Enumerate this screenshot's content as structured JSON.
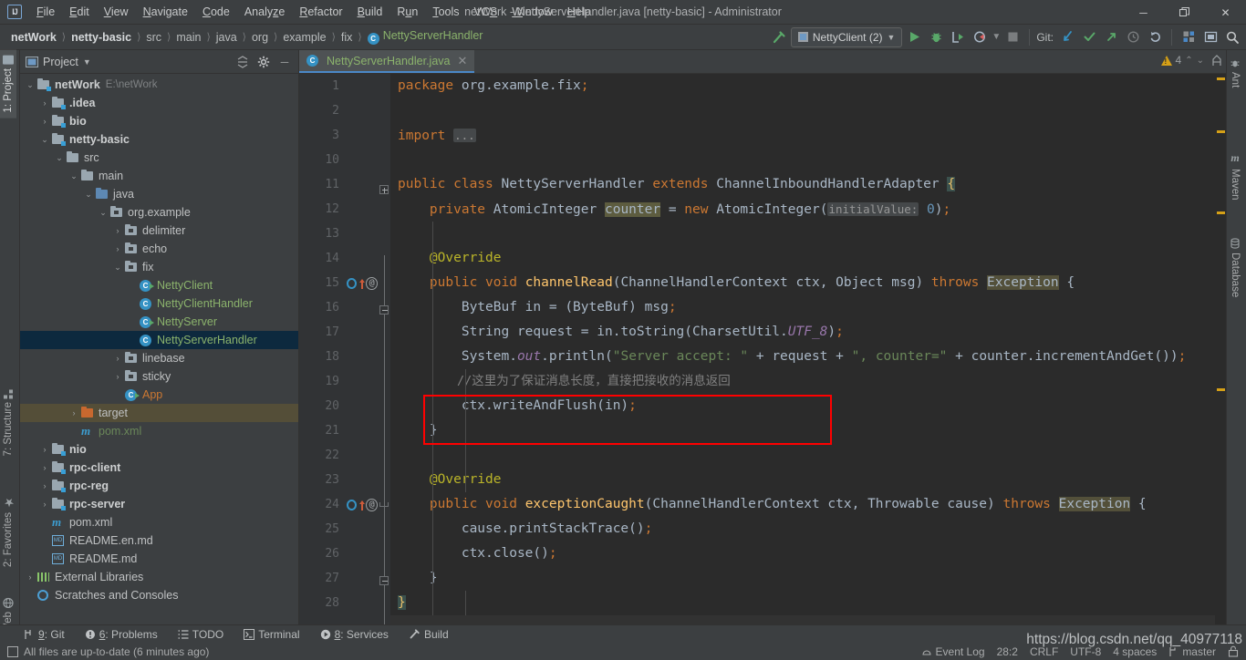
{
  "window": {
    "title": "netWork - NettyServerHandler.java [netty-basic] - Administrator",
    "logo": "IJ",
    "minimize": "─",
    "maximize": "❐",
    "close": "✕"
  },
  "menubar": [
    {
      "label": "File",
      "mnemonic": "F"
    },
    {
      "label": "Edit",
      "mnemonic": "E"
    },
    {
      "label": "View",
      "mnemonic": "V"
    },
    {
      "label": "Navigate",
      "mnemonic": "N"
    },
    {
      "label": "Code",
      "mnemonic": "C"
    },
    {
      "label": "Analyze",
      "mnemonic": "z"
    },
    {
      "label": "Refactor",
      "mnemonic": "R"
    },
    {
      "label": "Build",
      "mnemonic": "B"
    },
    {
      "label": "Run",
      "mnemonic": "u"
    },
    {
      "label": "Tools",
      "mnemonic": "T"
    },
    {
      "label": "VCS",
      "mnemonic": "S"
    },
    {
      "label": "Window",
      "mnemonic": "W"
    },
    {
      "label": "Help",
      "mnemonic": "H"
    }
  ],
  "breadcrumbs": [
    {
      "label": "netWork",
      "style": "bold"
    },
    {
      "label": "netty-basic",
      "style": "bold"
    },
    {
      "label": "src",
      "style": "plain"
    },
    {
      "label": "main",
      "style": "plain"
    },
    {
      "label": "java",
      "style": "plain"
    },
    {
      "label": "org",
      "style": "plain"
    },
    {
      "label": "example",
      "style": "plain"
    },
    {
      "label": "fix",
      "style": "plain"
    },
    {
      "label": "NettyServerHandler",
      "style": "class"
    }
  ],
  "toolbar": {
    "build_icon": "hammer-icon",
    "run_config": "NettyClient (2)",
    "run_label": "run-button",
    "debug_label": "debug-button",
    "coverage_label": "run-with-coverage-button",
    "profile_label": "profiler-button",
    "stop_label": "stop-button",
    "git_label": "Git:",
    "git_update": "update-project-icon",
    "git_commit": "commit-icon",
    "git_push": "push-icon",
    "git_history": "history-icon",
    "git_rollback": "rollback-icon",
    "settings_icon": "settings-icon",
    "layout_icon": "layout-icon",
    "search_icon": "search-icon"
  },
  "left_strip": [
    {
      "label": "1: Project",
      "icon": "project-icon",
      "selected": true
    },
    {
      "label": "7: Structure",
      "icon": "structure-icon",
      "selected": false
    },
    {
      "label": "2: Favorites",
      "icon": "star-icon",
      "selected": false
    },
    {
      "label": "Web",
      "icon": "globe-icon",
      "selected": false
    }
  ],
  "right_strip": [
    {
      "label": "Ant",
      "icon": "ant-icon"
    },
    {
      "label": "Maven",
      "icon": "maven-icon"
    },
    {
      "label": "Database",
      "icon": "database-icon"
    }
  ],
  "project_panel": {
    "title": "Project",
    "dropdown_icon": "chevron-down-icon",
    "collapse_icon": "collapse-all-icon",
    "settings_icon": "gear-icon",
    "hide_icon": "hide-icon",
    "tree": [
      {
        "depth": 0,
        "arrow": "v",
        "icon": "module-folder",
        "label": "netWork",
        "style": "b",
        "sub": "E:\\netWork"
      },
      {
        "depth": 1,
        "arrow": ">",
        "icon": "module-folder",
        "label": ".idea",
        "style": "b",
        "sub": ""
      },
      {
        "depth": 1,
        "arrow": ">",
        "icon": "module-folder",
        "label": "bio",
        "style": "b",
        "sub": ""
      },
      {
        "depth": 1,
        "arrow": "v",
        "icon": "module-folder",
        "label": "netty-basic",
        "style": "b",
        "sub": ""
      },
      {
        "depth": 2,
        "arrow": "v",
        "icon": "folder",
        "label": "src",
        "style": "plain",
        "sub": ""
      },
      {
        "depth": 3,
        "arrow": "v",
        "icon": "folder",
        "label": "main",
        "style": "plain",
        "sub": ""
      },
      {
        "depth": 4,
        "arrow": "v",
        "icon": "source-folder",
        "label": "java",
        "style": "plain",
        "sub": ""
      },
      {
        "depth": 5,
        "arrow": "v",
        "icon": "package",
        "label": "org.example",
        "style": "plain",
        "sub": ""
      },
      {
        "depth": 6,
        "arrow": ">",
        "icon": "package",
        "label": "delimiter",
        "style": "plain",
        "sub": ""
      },
      {
        "depth": 6,
        "arrow": ">",
        "icon": "package",
        "label": "echo",
        "style": "plain",
        "sub": ""
      },
      {
        "depth": 6,
        "arrow": "v",
        "icon": "package",
        "label": "fix",
        "style": "plain",
        "sub": ""
      },
      {
        "depth": 7,
        "arrow": "",
        "icon": "class-runnable",
        "label": "NettyClient",
        "style": "java",
        "sub": ""
      },
      {
        "depth": 7,
        "arrow": "",
        "icon": "class",
        "label": "NettyClientHandler",
        "style": "java",
        "sub": ""
      },
      {
        "depth": 7,
        "arrow": "",
        "icon": "class-runnable",
        "label": "NettyServer",
        "style": "java",
        "sub": ""
      },
      {
        "depth": 7,
        "arrow": "",
        "icon": "class",
        "label": "NettyServerHandler",
        "style": "java",
        "sub": "",
        "state": "sel"
      },
      {
        "depth": 6,
        "arrow": ">",
        "icon": "package",
        "label": "linebase",
        "style": "plain",
        "sub": ""
      },
      {
        "depth": 6,
        "arrow": ">",
        "icon": "package",
        "label": "sticky",
        "style": "plain",
        "sub": ""
      },
      {
        "depth": 6,
        "arrow": "",
        "icon": "class-runnable-red",
        "label": "App",
        "style": "orange",
        "sub": ""
      },
      {
        "depth": 3,
        "arrow": ">",
        "icon": "folder-orange",
        "label": "target",
        "style": "plain",
        "sub": "",
        "state": "hl"
      },
      {
        "depth": 3,
        "arrow": "",
        "icon": "maven",
        "label": "pom.xml",
        "style": "green",
        "sub": ""
      },
      {
        "depth": 1,
        "arrow": ">",
        "icon": "module-folder",
        "label": "nio",
        "style": "b",
        "sub": ""
      },
      {
        "depth": 1,
        "arrow": ">",
        "icon": "module-folder",
        "label": "rpc-client",
        "style": "b",
        "sub": ""
      },
      {
        "depth": 1,
        "arrow": ">",
        "icon": "module-folder",
        "label": "rpc-reg",
        "style": "b",
        "sub": ""
      },
      {
        "depth": 1,
        "arrow": ">",
        "icon": "module-folder",
        "label": "rpc-server",
        "style": "b",
        "sub": ""
      },
      {
        "depth": 1,
        "arrow": "",
        "icon": "maven",
        "label": "pom.xml",
        "style": "plain",
        "sub": ""
      },
      {
        "depth": 1,
        "arrow": "",
        "icon": "markdown",
        "label": "README.en.md",
        "style": "plain",
        "sub": ""
      },
      {
        "depth": 1,
        "arrow": "",
        "icon": "markdown",
        "label": "README.md",
        "style": "plain",
        "sub": ""
      },
      {
        "depth": 0,
        "arrow": ">",
        "icon": "libraries",
        "label": "External Libraries",
        "style": "plain",
        "sub": ""
      },
      {
        "depth": 0,
        "arrow": "",
        "icon": "scratches",
        "label": "Scratches and Consoles",
        "style": "plain",
        "sub": ""
      }
    ]
  },
  "editor": {
    "tab": {
      "label": "NettyServerHandler.java",
      "icon": "java-class-icon",
      "close": "✕"
    },
    "warnings": {
      "count": "4",
      "icon": "warning-icon",
      "up": "⌃",
      "down": "⌄"
    },
    "line_numbers": [
      "1",
      "2",
      "3",
      "10",
      "11",
      "12",
      "13",
      "14",
      "15",
      "16",
      "17",
      "18",
      "19",
      "20",
      "21",
      "22",
      "23",
      "24",
      "25",
      "26",
      "27",
      "28"
    ],
    "lines": [
      {
        "n": "1",
        "indent": 0,
        "code": "package org.example.fix;"
      },
      {
        "n": "2",
        "indent": 0,
        "code": ""
      },
      {
        "n": "3",
        "indent": 0,
        "code": "import ..."
      },
      {
        "n": "10",
        "indent": 0,
        "code": ""
      },
      {
        "n": "11",
        "indent": 0,
        "code": "public class NettyServerHandler extends ChannelInboundHandlerAdapter {"
      },
      {
        "n": "12",
        "indent": 1,
        "code": "private AtomicInteger counter = new AtomicInteger( initialValue: 0);"
      },
      {
        "n": "13",
        "indent": 1,
        "code": ""
      },
      {
        "n": "14",
        "indent": 1,
        "code": "@Override"
      },
      {
        "n": "15",
        "indent": 1,
        "code": "public void channelRead(ChannelHandlerContext ctx, Object msg) throws Exception {"
      },
      {
        "n": "16",
        "indent": 2,
        "code": "ByteBuf in = (ByteBuf) msg;"
      },
      {
        "n": "17",
        "indent": 2,
        "code": "String request = in.toString(CharsetUtil.UTF_8);"
      },
      {
        "n": "18",
        "indent": 2,
        "code": "System.out.println(\"Server accept: \" + request + \", counter=\" + counter.incrementAndGet());"
      },
      {
        "n": "19",
        "indent": 2,
        "code": "//这里为了保证消息长度，直接把接收的消息返回"
      },
      {
        "n": "20",
        "indent": 2,
        "code": "ctx.writeAndFlush(in);"
      },
      {
        "n": "21",
        "indent": 1,
        "code": "}"
      },
      {
        "n": "22",
        "indent": 1,
        "code": ""
      },
      {
        "n": "23",
        "indent": 1,
        "code": "@Override"
      },
      {
        "n": "24",
        "indent": 1,
        "code": "public void exceptionCaught(ChannelHandlerContext ctx, Throwable cause) throws Exception {"
      },
      {
        "n": "25",
        "indent": 2,
        "code": "cause.printStackTrace();"
      },
      {
        "n": "26",
        "indent": 2,
        "code": "ctx.close();"
      },
      {
        "n": "27",
        "indent": 1,
        "code": "}"
      },
      {
        "n": "28",
        "indent": 0,
        "code": "}"
      }
    ],
    "inlay_hint": "initialValue:",
    "gutter_icons": [
      {
        "line": "15",
        "icons": [
          "override-method-icon",
          "annotation-icon"
        ]
      },
      {
        "line": "24",
        "icons": [
          "override-method-icon",
          "annotation-icon"
        ]
      }
    ],
    "annotation_box": {
      "color": "#ff0000",
      "covers_lines": [
        "19",
        "20"
      ]
    }
  },
  "bottom_tools": [
    {
      "label": "9: Git",
      "num": "9",
      "rest": ": Git",
      "icon": "git-branch-icon"
    },
    {
      "label": "6: Problems",
      "num": "6",
      "rest": ": Problems",
      "icon": "problems-icon"
    },
    {
      "label": "TODO",
      "num": "",
      "rest": "TODO",
      "icon": "todo-icon"
    },
    {
      "label": "Terminal",
      "num": "",
      "rest": "Terminal",
      "icon": "terminal-icon"
    },
    {
      "label": "8: Services",
      "num": "8",
      "rest": ": Services",
      "icon": "services-icon"
    },
    {
      "label": "Build",
      "num": "",
      "rest": "Build",
      "icon": "build-icon"
    }
  ],
  "status": {
    "message": "All files are up-to-date (6 minutes ago)",
    "message_icon": "vcs-icon",
    "caret": "28:2",
    "line_sep": "CRLF",
    "encoding": "UTF-8",
    "indent": "4 spaces",
    "branch": "master",
    "branch_icon": "branch-icon",
    "lock_icon": "lock-icon",
    "event_log": "Event Log",
    "event_log_icon": "event-log-icon"
  },
  "watermark": "https://blog.csdn.net/qq_40977118",
  "colors": {
    "accent": "#4a88c7",
    "keyword": "#cc7832",
    "string": "#6a8759",
    "annotation": "#bbb529",
    "method": "#ffc66d",
    "comment": "#808080",
    "selection": "#0d293e",
    "highlight_box": "#ff0000",
    "editor_bg": "#2b2b2b",
    "chrome_bg": "#3c3f41"
  }
}
